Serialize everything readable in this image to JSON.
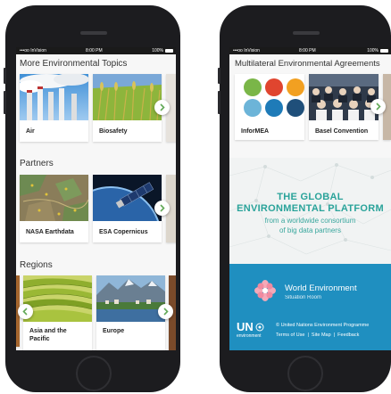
{
  "left_phone": {
    "status": {
      "carrier": "•••oo InVision",
      "time": "8:00 PM",
      "battery": "100%"
    },
    "sections": [
      {
        "title": "More Environmental Topics",
        "cards": [
          {
            "label": "Air"
          },
          {
            "label": "Biosafety"
          }
        ]
      },
      {
        "title": "Partners",
        "cards": [
          {
            "label": "NASA Earthdata"
          },
          {
            "label": "ESA Copernicus"
          }
        ]
      },
      {
        "title": "Regions",
        "cards": [
          {
            "label": "Asia and the Pacific"
          },
          {
            "label": "Europe"
          }
        ]
      }
    ]
  },
  "right_phone": {
    "status": {
      "carrier": "•••oo InVision",
      "time": "8:00 PM",
      "battery": "100%"
    },
    "mea": {
      "title": "Multilateral Environmental Agreements",
      "cards": [
        {
          "label": "InforMEA"
        },
        {
          "label": "Basel Convention"
        }
      ]
    },
    "platform": {
      "line1": "THE GLOBAL",
      "line2": "ENVIRONMENTAL PLATFORM",
      "sub1": "from a worldwide consortium",
      "sub2": "of big data partners"
    },
    "footer": {
      "brand_title": "World Environment",
      "brand_sub": "Situation Room",
      "un_logo": "UN",
      "un_sub": "environment",
      "copyright": "© United Nations Environment Programme",
      "links": "Terms of Use  |  Site Map  |  Feedback"
    }
  },
  "colors": {
    "phone_body": "#1c1c1f",
    "teal_text": "#2aa39a",
    "footer_blue": "#1f8fc0",
    "arrow_green": "#62a957"
  }
}
